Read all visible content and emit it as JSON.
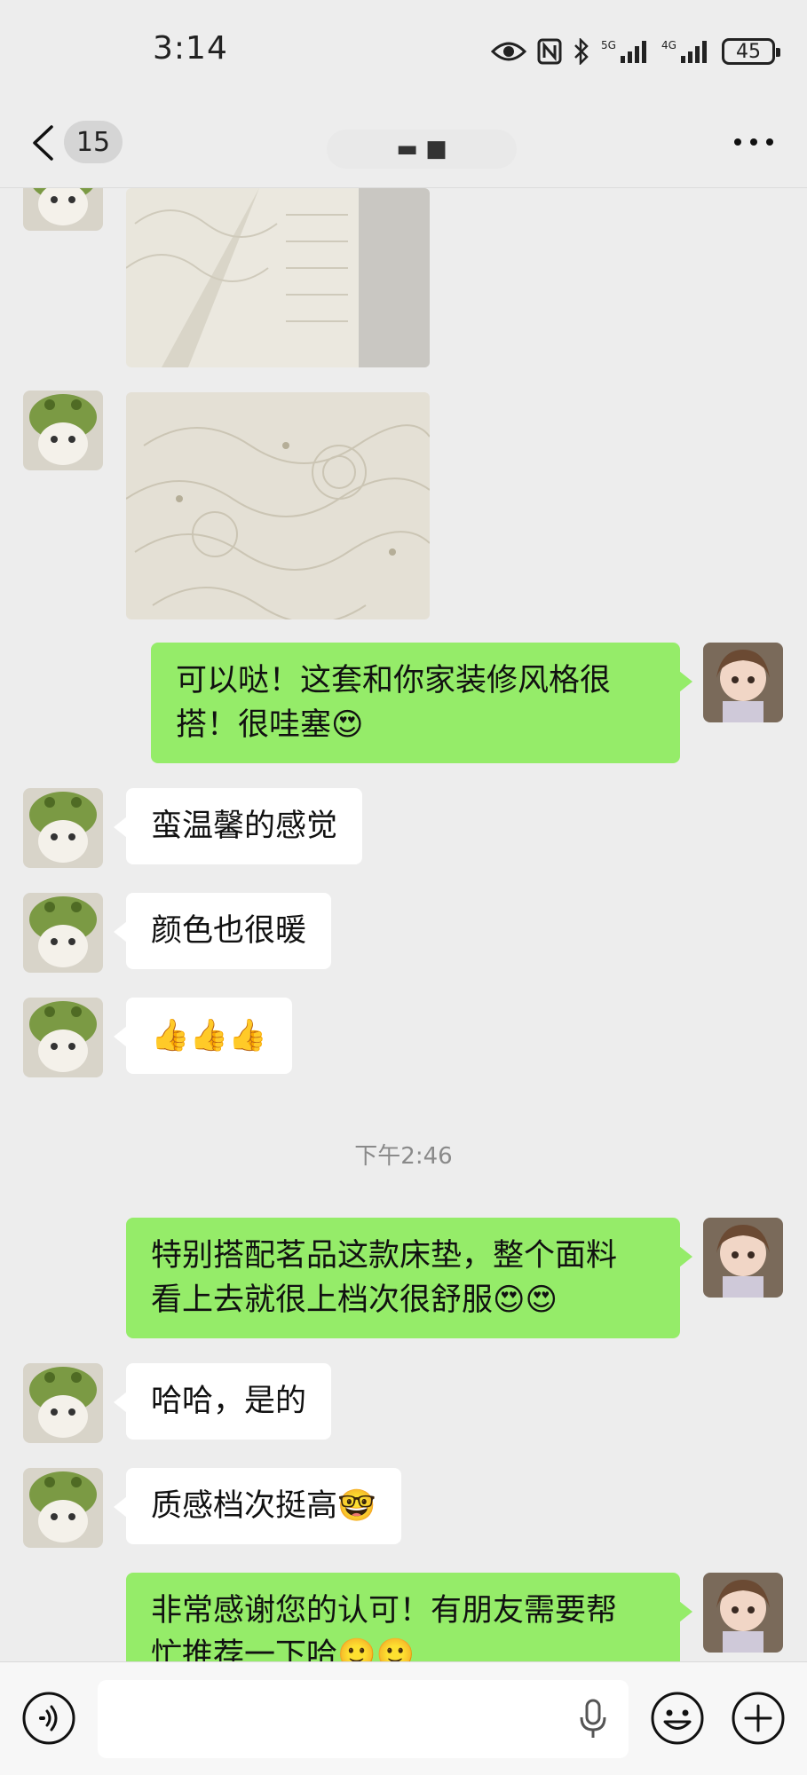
{
  "status": {
    "time": "3:14",
    "battery": "45",
    "net1": "5G",
    "net2": "4G"
  },
  "nav": {
    "unread_count": "15",
    "title": "▬ ■"
  },
  "messages": {
    "m1": "可以哒！这套和你家装修风格很\n搭！很哇塞😍",
    "m2": "蛮温馨的感觉",
    "m3": "颜色也很暖",
    "m4": "👍👍👍",
    "time_sep": "下午2:46",
    "m5": "特别搭配茗品这款床垫，整个面料\n看上去就很上档次很舒服😍😍",
    "m6": "哈哈，是的",
    "m7": "质感档次挺高🤓",
    "m8": "非常感谢您的认可！有朋友需要帮\n忙推荐一下哈🙂🙂"
  },
  "input": {
    "value": "",
    "placeholder": ""
  },
  "icons": {
    "voice": "voice-toggle-icon",
    "emoji": "emoji-icon",
    "plus": "plus-icon",
    "mic": "microphone-icon"
  },
  "colors": {
    "outgoing_bubble": "#95ec69",
    "incoming_bubble": "#ffffff",
    "background": "#ededed"
  }
}
